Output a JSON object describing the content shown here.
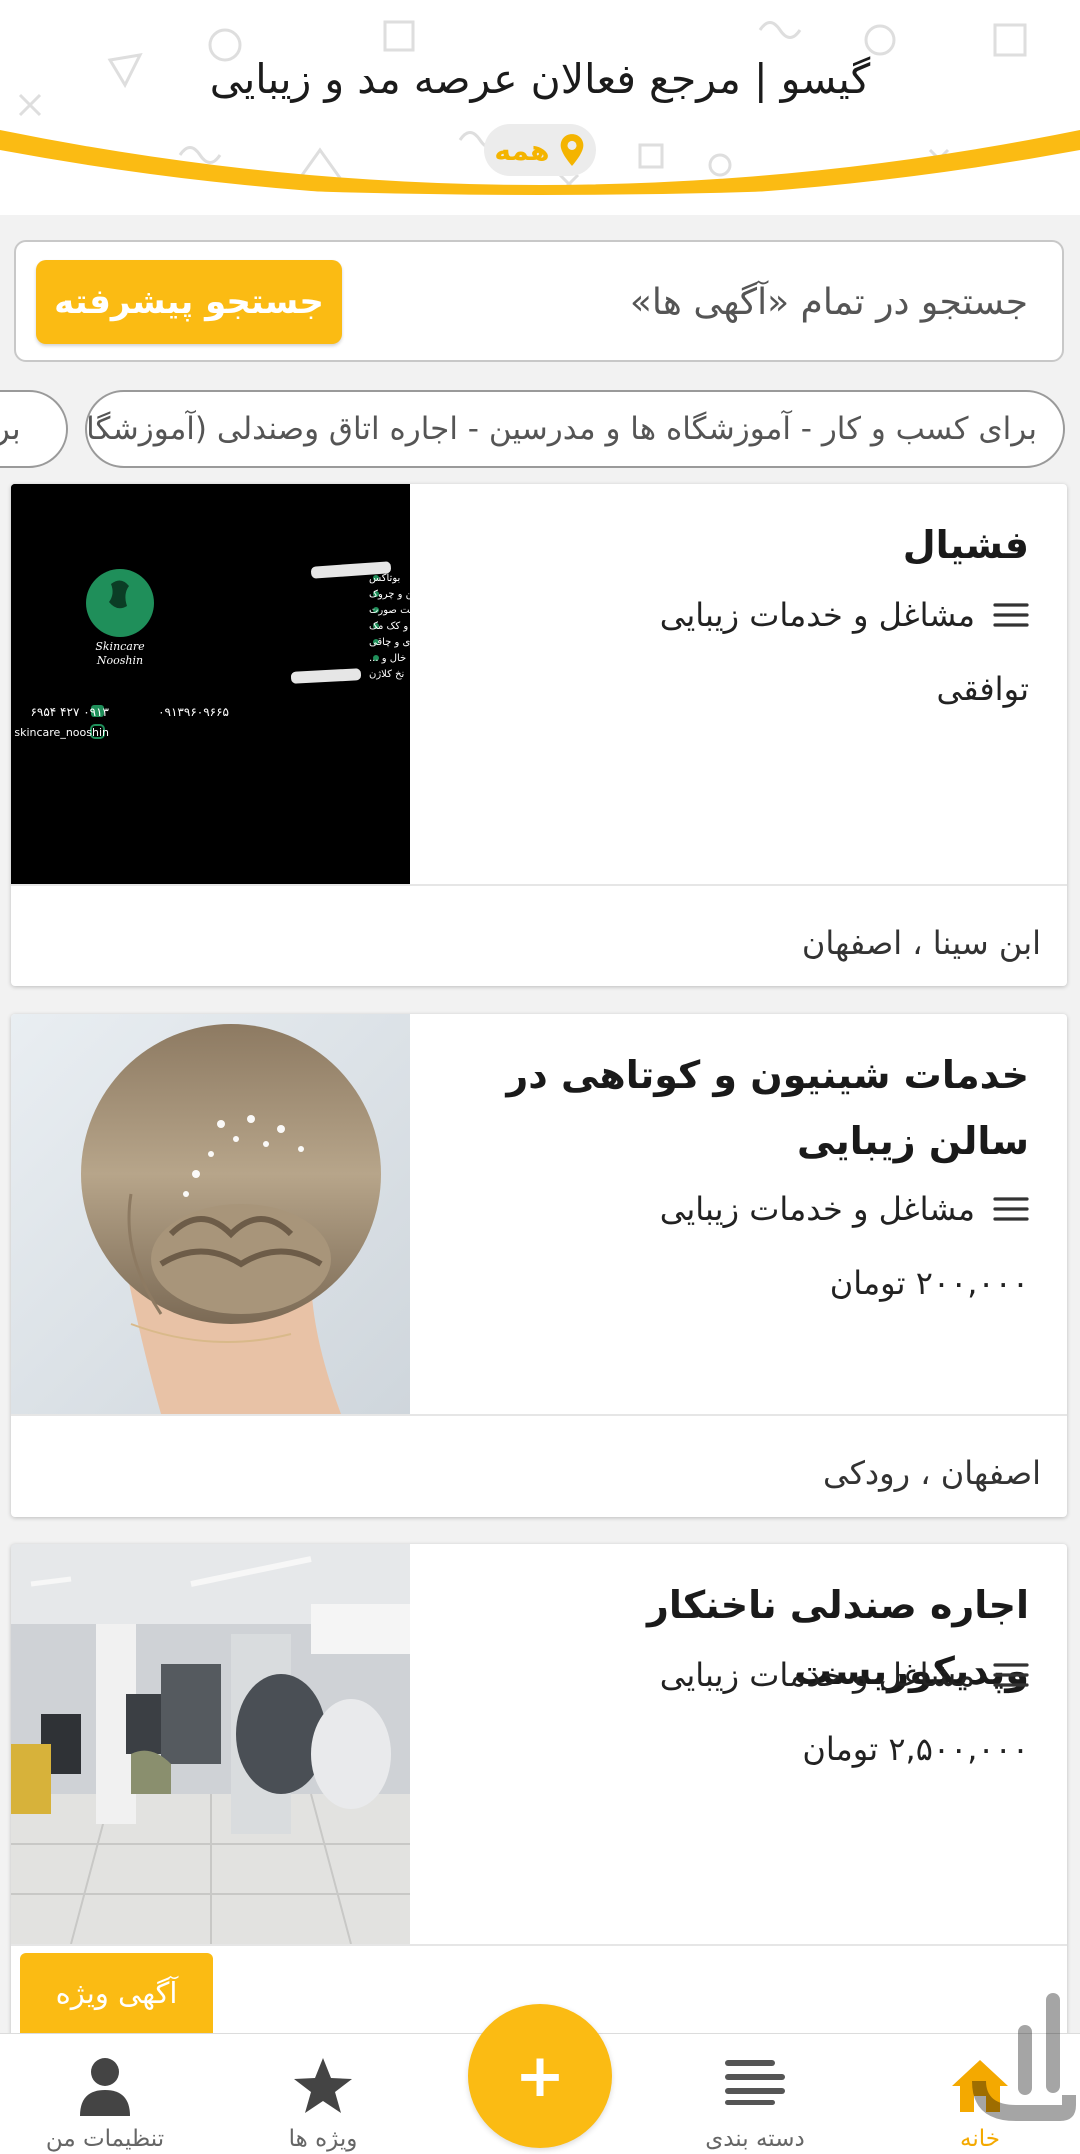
{
  "header": {
    "title": "گیسو | مرجع فعالان عرصه مد و زیبایی",
    "location_label": "همه"
  },
  "search": {
    "placeholder": "جستجو در تمام «آگهی ها»",
    "advanced_label": "جستجو پیشرفته"
  },
  "chips": [
    {
      "label": "برای کسب و کار - آموزشگاه ها و مدرسین - اجاره اتاق وصندلی (آموزشگاه)"
    },
    {
      "label": "برای"
    }
  ],
  "listings": [
    {
      "title": "فشیال",
      "category": "مشاغل و خدمات زیبایی",
      "price": "توافقی",
      "location": "ابن سینا ، اصفهان",
      "image_content": {
        "logo_top": "Skincare",
        "logo_bottom": "Nooshin",
        "lines": [
          "بوتاکس",
          "درمان چین و چروک",
          "جوان سازی و لیفت پوست صورت",
          "رفع جای بخیه، جوش، سوختگی و کک مک",
          "از بین برنده ترک‌های پوستی بارداری و چاقی",
          "برداشتن خال و ...",
          "نخ کلاژن"
        ],
        "phone_1": "۰۹۱۳۹۶۰۹۶۶۵",
        "phone_2": "۰۹۱۳ ۴۲۷ ۶۹۵۴",
        "instagram": "skincare_nooshin"
      }
    },
    {
      "title": "خدمات شینیون و کوتاهی در سالن زیبایی",
      "category": "مشاغل و خدمات زیبایی",
      "price": "۲۰۰,۰۰۰ تومان",
      "location": "اصفهان ، رودکی"
    },
    {
      "title": "اجاره صندلی ناخنکار وپدیکوریست",
      "category": "مشاغل و خدمات زیبایی",
      "price": "۲,۵۰۰,۰۰۰ تومان",
      "location": ""
    }
  ],
  "featured_badge": "آگهی ویژه",
  "bottom_nav": {
    "home": "خانه",
    "categories": "دسته بندی",
    "add": "+",
    "featured": "ویژه ها",
    "settings": "تنظیمات من"
  },
  "icons": {
    "location": "map-pin-icon",
    "category": "list-icon",
    "home": "home-icon",
    "categories": "menu-icon",
    "featured": "star-icon",
    "settings": "user-icon",
    "add": "plus-icon"
  },
  "colors": {
    "accent": "#fbbb13",
    "accent_text": "#f4b400",
    "text": "#1a1a1a",
    "muted": "#666666",
    "green_logo": "#1f8f5a"
  }
}
